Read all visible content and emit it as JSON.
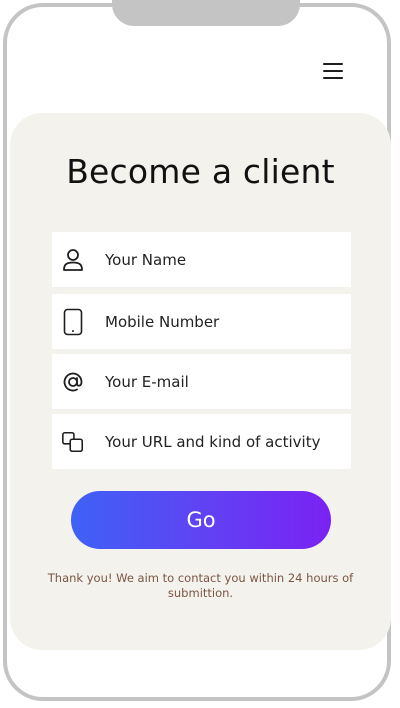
{
  "header": {
    "menu_icon": "hamburger-menu-icon"
  },
  "form": {
    "title": "Become a client",
    "fields": [
      {
        "icon": "user-icon",
        "placeholder": "Your Name"
      },
      {
        "icon": "mobile-phone-icon",
        "placeholder": "Mobile Number"
      },
      {
        "icon": "at-sign-icon",
        "placeholder": "Your E-mail"
      },
      {
        "icon": "copy-squares-icon",
        "placeholder": "Your URL and kind of activity"
      }
    ],
    "submit_label": "Go",
    "note": "Thank you! We aim to contact you within 24 hours of submittion."
  },
  "colors": {
    "card_background": "#f4f2ed",
    "button_gradient_start": "#3e61f6",
    "button_gradient_end": "#7a22f3",
    "note_text": "#7a5642",
    "frame": "#c4c4c4"
  }
}
